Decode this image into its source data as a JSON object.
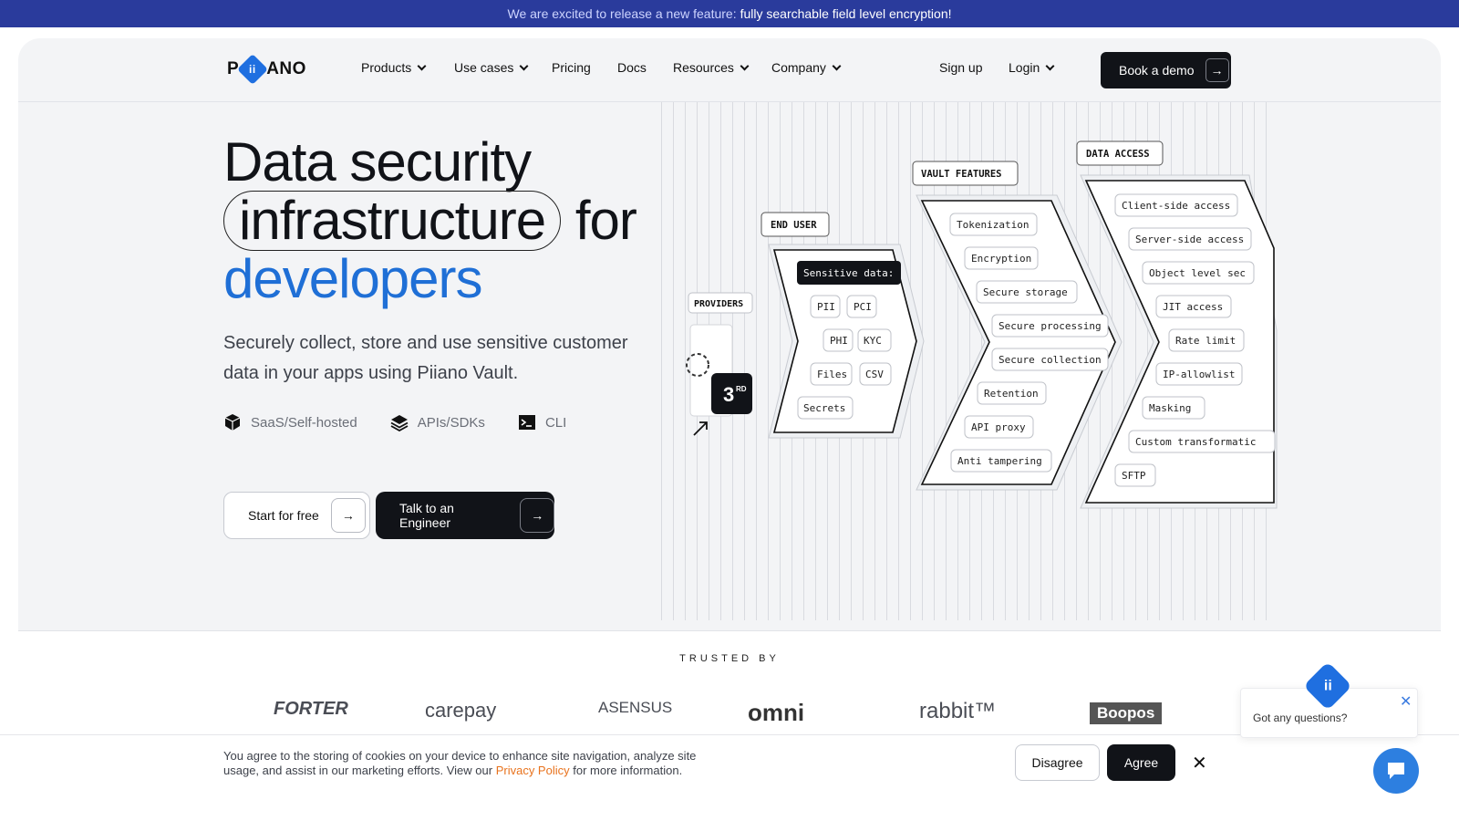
{
  "announcement": {
    "lead": "We are excited to release a new feature:",
    "highlight": "fully searchable field level encryption!"
  },
  "nav": {
    "logo": "PIIANO",
    "items": [
      {
        "label": "Products",
        "has_dropdown": true
      },
      {
        "label": "Use cases",
        "has_dropdown": true
      },
      {
        "label": "Pricing",
        "has_dropdown": false
      },
      {
        "label": "Docs",
        "has_dropdown": false
      },
      {
        "label": "Resources",
        "has_dropdown": true
      },
      {
        "label": "Company",
        "has_dropdown": true
      }
    ],
    "signup": "Sign up",
    "login": "Login",
    "demo": "Book a demo"
  },
  "hero": {
    "line1": "Data security",
    "line2_pill": "infrastructure",
    "line2_rest": "for",
    "line3": "developers",
    "subtitle": "Securely collect, store and use sensitive customer data in your apps using Piiano Vault.",
    "features": [
      "SaaS/Self-hosted",
      "APIs/SDKs",
      "CLI"
    ],
    "cta_primary": "Start for free",
    "cta_secondary": "Talk to an Engineer"
  },
  "diagram": {
    "providers_label": "PROVIDERS",
    "third_badge": "3",
    "third_sup": "RD",
    "end_user": {
      "label": "END USER",
      "heading": "Sensitive data:",
      "items": [
        "PII",
        "PCI",
        "PHI",
        "KYC",
        "Files",
        "CSV",
        "Secrets"
      ]
    },
    "vault_features": {
      "label": "VAULT FEATURES",
      "items": [
        "Tokenization",
        "Encryption",
        "Secure storage",
        "Secure processing",
        "Secure collection",
        "Retention",
        "API proxy",
        "Anti tampering"
      ]
    },
    "data_access": {
      "label": "DATA ACCESS",
      "items": [
        "Client-side access",
        "Server-side access",
        "Object level sec",
        "JIT access",
        "Rate limit",
        "IP-allowlist",
        "Masking",
        "Custom transformatic",
        "SFTP"
      ]
    }
  },
  "trusted": {
    "label": "TRUSTED BY",
    "brands": [
      "FORTER",
      "carepay",
      "ASENSUS",
      "omni",
      "rabbit™",
      "Boopos"
    ]
  },
  "cookie": {
    "text_before": "You agree to the storing of cookies on your device to enhance site navigation, analyze site usage, and assist in our marketing efforts. View our",
    "link": "Privacy Policy",
    "text_after": "for more information.",
    "disagree": "Disagree",
    "agree": "Agree"
  },
  "chat": {
    "prompt": "Got any questions?"
  },
  "colors": {
    "announce_bg": "#2a3b9c",
    "brand_blue": "#1f6fd6",
    "dark": "#111318",
    "link_orange": "#e8731e"
  }
}
